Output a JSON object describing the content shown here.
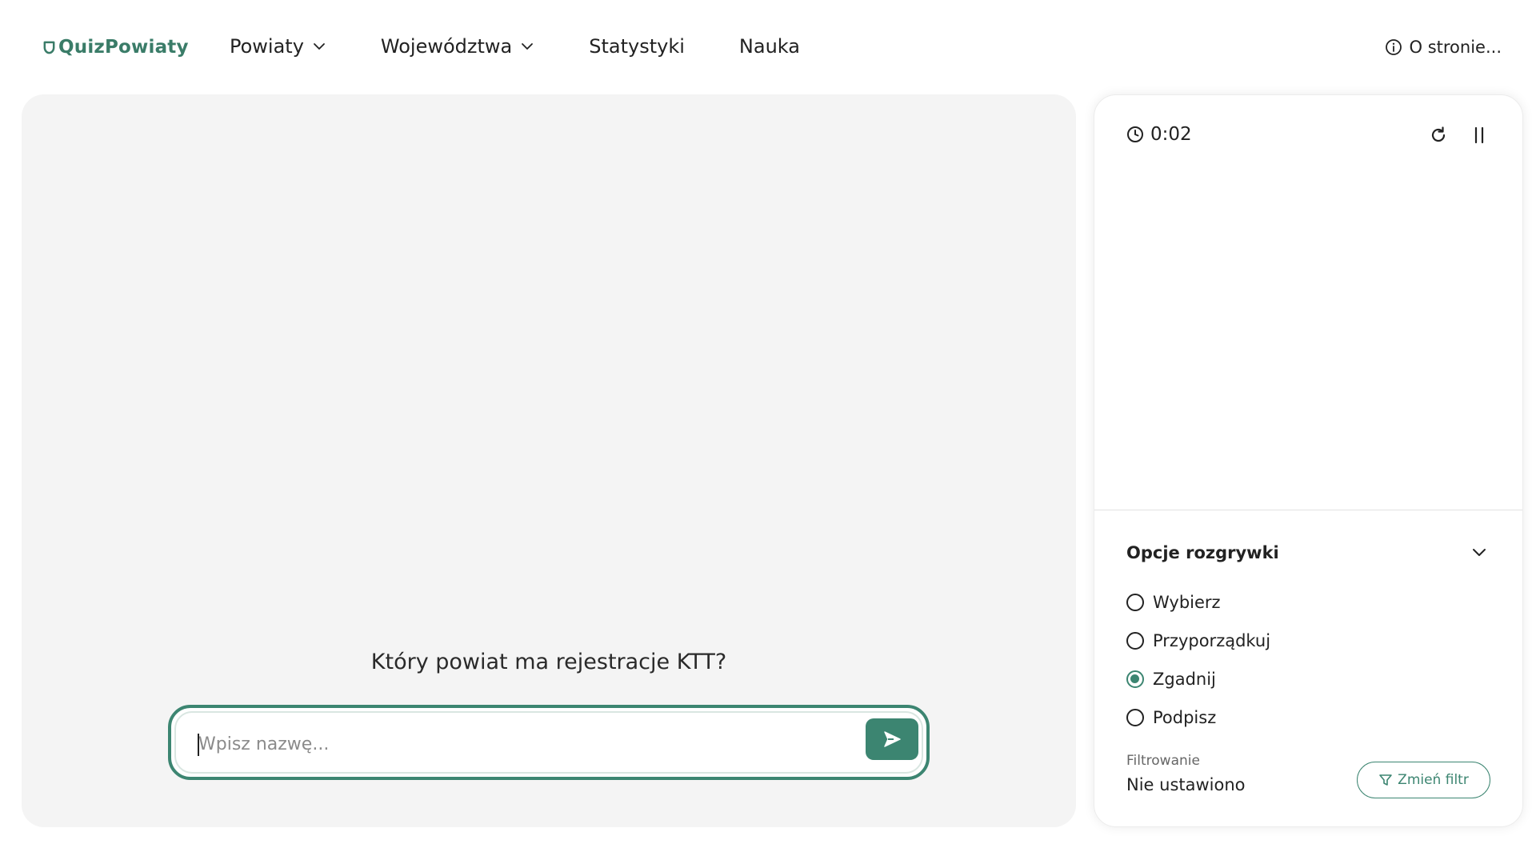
{
  "header": {
    "logo_text": "QuizPowiaty",
    "nav": [
      {
        "label": "Powiaty",
        "has_dropdown": true
      },
      {
        "label": "Województwa",
        "has_dropdown": true
      },
      {
        "label": "Statystyki",
        "has_dropdown": false
      },
      {
        "label": "Nauka",
        "has_dropdown": false
      }
    ],
    "about_label": "O stronie..."
  },
  "quiz": {
    "question": "Który powiat ma rejestracje KTT?",
    "input_placeholder": "Wpisz nazwę...",
    "input_value": ""
  },
  "sidebar": {
    "timer": "0:02",
    "options_title": "Opcje rozgrywki",
    "modes": [
      {
        "label": "Wybierz",
        "checked": false
      },
      {
        "label": "Przyporządkuj",
        "checked": false
      },
      {
        "label": "Zgadnij",
        "checked": true
      },
      {
        "label": "Podpisz",
        "checked": false
      }
    ],
    "filter_label": "Filtrowanie",
    "filter_value": "Nie ustawiono",
    "filter_button": "Zmień filtr"
  },
  "colors": {
    "accent": "#3c8571",
    "panel_bg": "#f4f4f4"
  }
}
